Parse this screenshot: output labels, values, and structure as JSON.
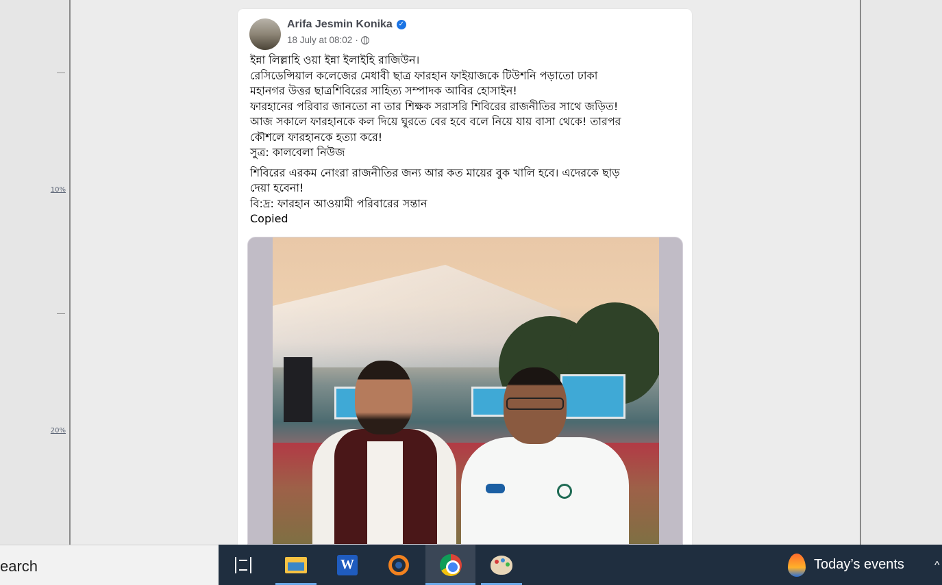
{
  "viewer": {
    "ruler_labels": [
      "10%",
      "20%"
    ]
  },
  "post": {
    "author": "Arifa Jesmin Konika",
    "verified_icon": "verified-badge-icon",
    "timestamp": "18 July at 08:02",
    "separator": "·",
    "audience_icon": "globe-icon",
    "paragraph1": "ইন্না লিল্লাহি ওয়া ইন্না ইলাইহি রাজিউন।\nরেসিডেন্সিয়াল কলেজের মেধাবী ছাত্র ফারহান ফাইয়াজকে টিউশনি পড়াতো ঢাকা\nমহানগর উত্তর ছাত্রশিবিরের সাহিত্য সম্পাদক আবির হোসাইন!\nফারহানের পরিবার জানতো না তার শিক্ষক সরাসরি শিবিরের রাজনীতির সাথে জড়িত!\nআজ সকালে ফারহানকে কল দিয়ে ঘুরতে বের হবে বলে নিয়ে যায় বাসা থেকে! তারপর\nকৌশলে ফারহানকে হত্যা করে!\nসুত্র: কালবেলা নিউজ",
    "paragraph2": "শিবিরের এরকম নোংরা রাজনীতির জন্য আর কত মায়ের বুক খালি হবে। এদেরকে ছাড়\nদেয়া হবেনা!\nবি:দ্র: ফারহান  আওয়ামী পরিবারের সন্তান\nCopied"
  },
  "taskbar": {
    "search_text": "earch",
    "apps": [
      {
        "name": "task-view-icon"
      },
      {
        "name": "file-explorer-icon"
      },
      {
        "name": "word-icon"
      },
      {
        "name": "blender-icon"
      },
      {
        "name": "chrome-icon"
      },
      {
        "name": "paint-icon"
      }
    ],
    "word_letter": "W",
    "events_label": "Today’s events",
    "chevron": "^",
    "accent": "#6aa8e7"
  }
}
